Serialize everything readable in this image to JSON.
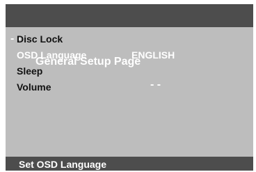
{
  "title_bar": {
    "dash_left": "- -",
    "title": "General Setup Page",
    "dash_right": "- -"
  },
  "menu": {
    "items": [
      {
        "label": "Disc Lock",
        "value": ""
      },
      {
        "label": "OSD Language",
        "value": "ENGLISH",
        "selected": true
      },
      {
        "label": "Sleep",
        "value": ""
      },
      {
        "label": "Volume",
        "value": ""
      }
    ]
  },
  "status_bar": {
    "text": "Set OSD Language"
  },
  "colors": {
    "panel_bg": "#bdbdbd",
    "bar_bg": "#4d4d4d",
    "highlight_text": "#ffffff",
    "normal_text": "#111111"
  }
}
